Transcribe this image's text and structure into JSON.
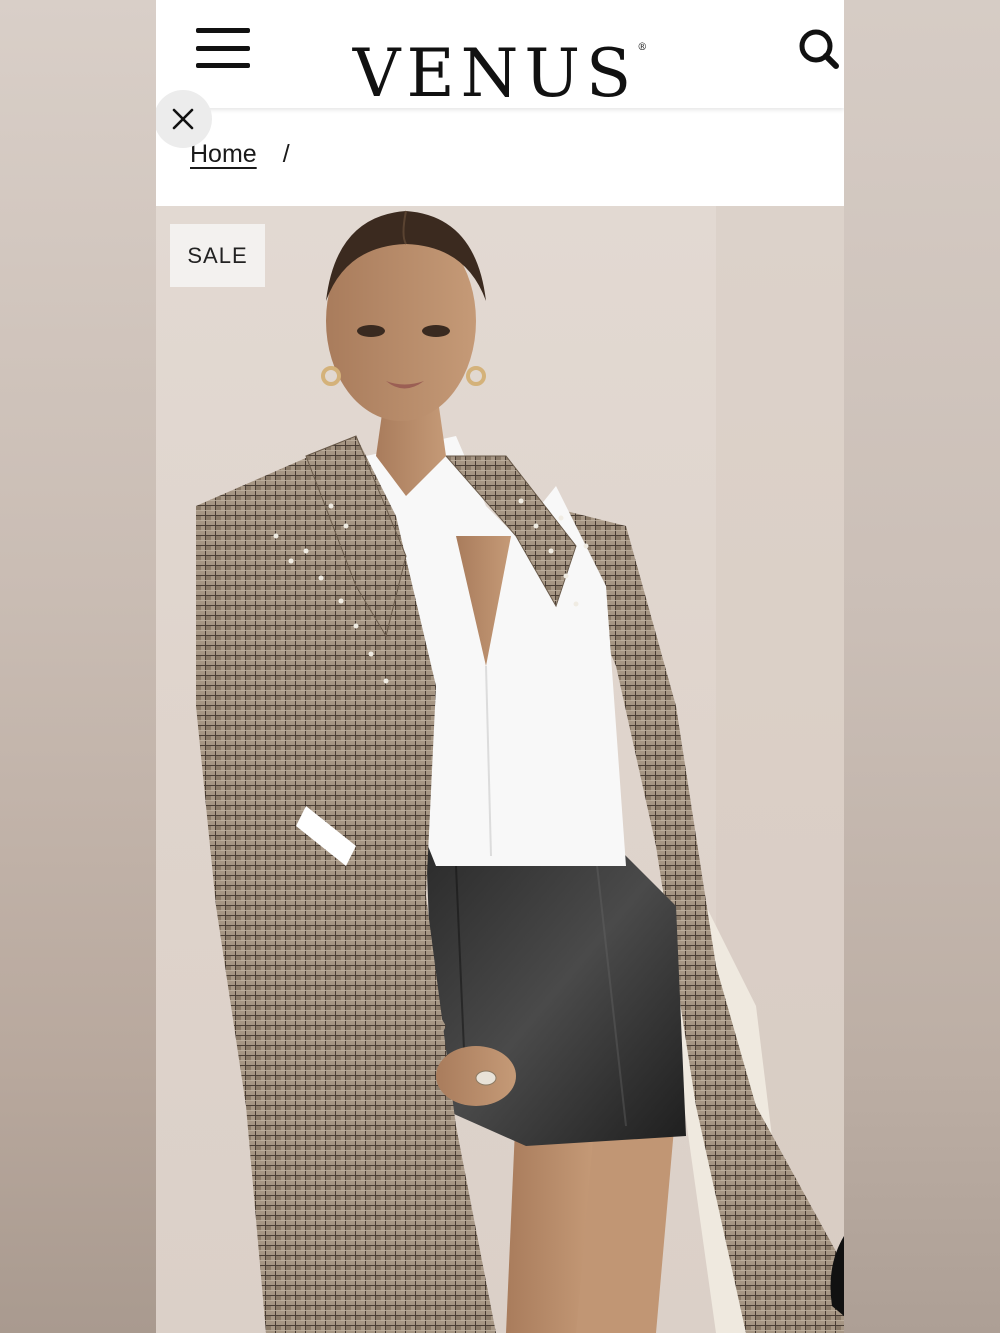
{
  "header": {
    "logo": "VENUS",
    "logo_mark": "®",
    "menu_icon": "hamburger-menu-icon",
    "search_icon": "search-icon"
  },
  "breadcrumb": {
    "home": "Home",
    "separator": "/"
  },
  "overlay": {
    "close_icon": "close-icon"
  },
  "product": {
    "badge": "SALE",
    "image": "model wearing houndstooth long coat, white shirt and black leather skirt"
  },
  "colors": {
    "header_bg": "#ffffff",
    "text": "#111111",
    "badge_bg": "#f3f1ef",
    "photo_bg": "#ddd3cb"
  }
}
